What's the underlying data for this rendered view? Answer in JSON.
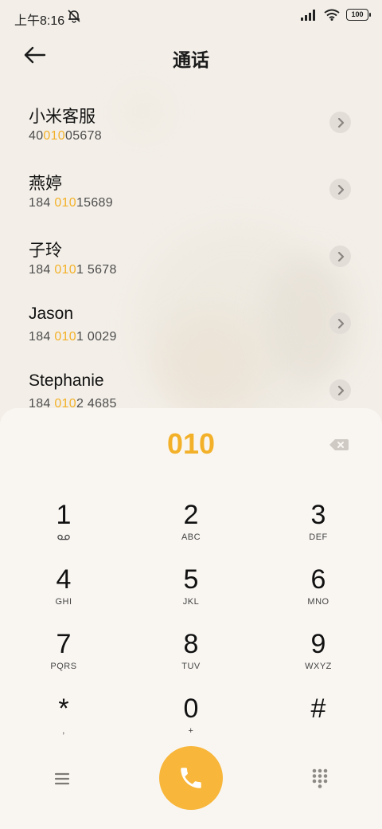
{
  "status": {
    "time": "上午8:16",
    "battery": "100"
  },
  "header": {
    "title": "通话"
  },
  "results": [
    {
      "name": "小米客服",
      "num_pre": "40",
      "num_hl": "010",
      "num_post": "05678"
    },
    {
      "name": "燕婷",
      "num_pre": "184 ",
      "num_hl": "010",
      "num_post": "15689"
    },
    {
      "name": "子玲",
      "num_pre": "184 ",
      "num_hl": "010",
      "num_post": "1 5678"
    },
    {
      "name": "Jason",
      "num_pre": "184 ",
      "num_hl": "010",
      "num_post": "1 0029"
    },
    {
      "name": "Stephanie",
      "num_pre": "184 ",
      "num_hl": "010",
      "num_post": "2 4685"
    }
  ],
  "dialer": {
    "typed": "010",
    "keys": [
      {
        "digit": "1",
        "letters": ""
      },
      {
        "digit": "2",
        "letters": "ABC"
      },
      {
        "digit": "3",
        "letters": "DEF"
      },
      {
        "digit": "4",
        "letters": "GHI"
      },
      {
        "digit": "5",
        "letters": "JKL"
      },
      {
        "digit": "6",
        "letters": "MNO"
      },
      {
        "digit": "7",
        "letters": "PQRS"
      },
      {
        "digit": "8",
        "letters": "TUV"
      },
      {
        "digit": "9",
        "letters": "WXYZ"
      },
      {
        "digit": "*",
        "letters": ","
      },
      {
        "digit": "0",
        "letters": "+"
      },
      {
        "digit": "#",
        "letters": ""
      }
    ]
  },
  "colors": {
    "accent": "#f3b129",
    "call_button": "#f8b63a",
    "background": "#f3efe8",
    "panel": "#f9f6f2"
  },
  "icons": {
    "back": "back-arrow-icon",
    "voicemail": "voicemail-icon",
    "backspace": "backspace-icon",
    "menu": "menu-icon",
    "call": "phone-icon",
    "keypad": "keypad-icon"
  }
}
